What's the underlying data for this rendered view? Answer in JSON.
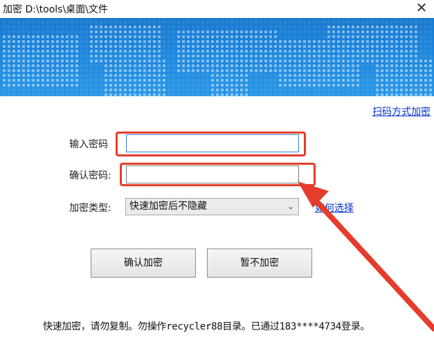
{
  "window": {
    "title": "加密 D:\\tools\\桌面\\文件",
    "close_glyph": "✕"
  },
  "links": {
    "scan_mode": "扫码方式加密",
    "how_to_choose": "如何选择"
  },
  "form": {
    "password_label": "输入密码",
    "confirm_label": "确认密码:",
    "type_label": "加密类型:",
    "password_value": "",
    "confirm_value": "",
    "type_selected": "快速加密后不隐藏"
  },
  "buttons": {
    "confirm": "确认加密",
    "skip": "暂不加密"
  },
  "status_text": "快速加密，请勿复制。勿操作recycler88目录。已通过183****4734登录。",
  "colors": {
    "banner": "#1d86dc",
    "highlight": "#e53c2b",
    "link": "#0033cc"
  },
  "icons": {
    "close": "close-icon",
    "dropdown": "chevron-down-icon"
  }
}
